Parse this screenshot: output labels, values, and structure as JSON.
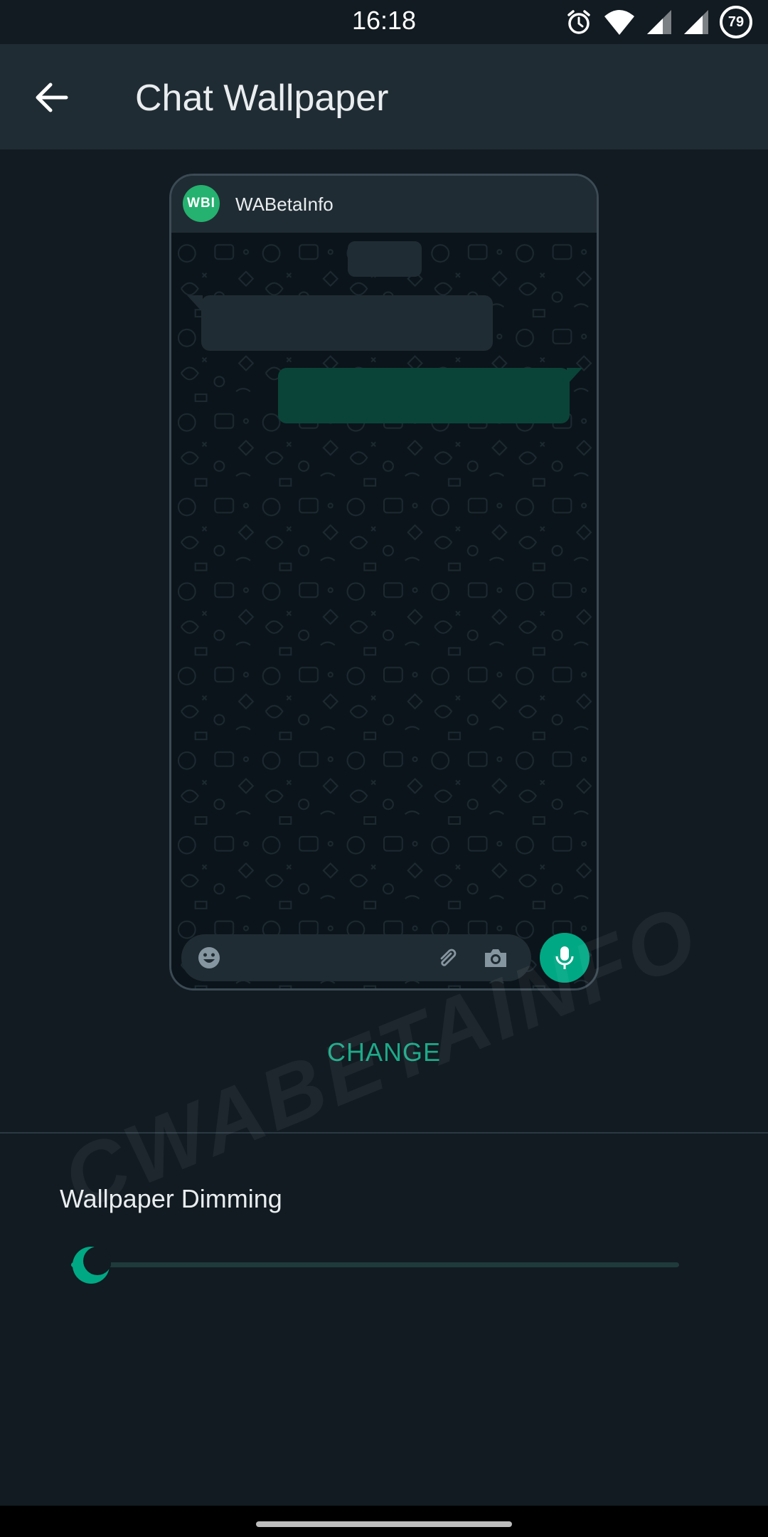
{
  "status_bar": {
    "time": "16:18",
    "battery": "79",
    "icons": [
      "alarm-icon",
      "wifi-icon",
      "signal-icon",
      "signal-icon",
      "battery-icon"
    ]
  },
  "app_bar": {
    "title": "Chat Wallpaper",
    "back_icon": "arrow-left-icon"
  },
  "preview": {
    "avatar_text": "WBI",
    "contact_name": "WABetaInfo",
    "input_icons": [
      "emoji-icon",
      "paperclip-icon",
      "camera-icon"
    ],
    "mic_icon": "mic-icon"
  },
  "change_label": "CHANGE",
  "dimming": {
    "label": "Wallpaper Dimming",
    "value": 0
  },
  "watermark": "CWABETAINFO",
  "colors": {
    "background": "#111b21",
    "header": "#202c33",
    "accent": "#00a884",
    "outgoing_bubble": "#0a4439",
    "avatar": "#25b16f"
  }
}
